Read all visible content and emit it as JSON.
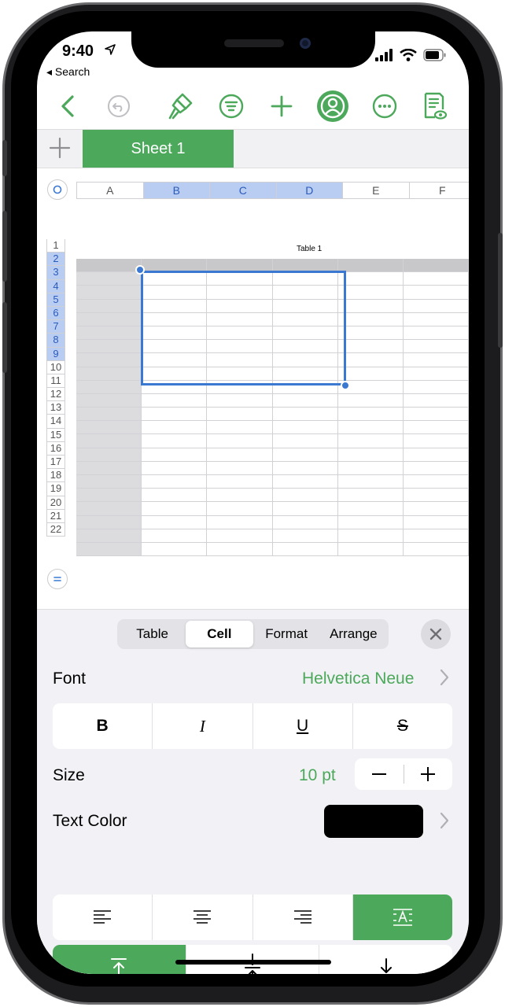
{
  "status_bar": {
    "time": "9:40",
    "location_icon": "location-arrow-icon",
    "back_label": "◂ Search"
  },
  "toolbar": {
    "icons": [
      "back-chevron-icon",
      "undo-icon",
      "paintbrush-icon",
      "filter-icon",
      "add-icon",
      "collaborate-icon",
      "more-icon",
      "reader-view-icon"
    ],
    "accent_color": "#4ca85a"
  },
  "tabs": {
    "add_label": "+",
    "sheets": [
      {
        "label": "Sheet 1",
        "active": true
      }
    ]
  },
  "spreadsheet": {
    "columns": [
      "A",
      "B",
      "C",
      "D",
      "E",
      "F"
    ],
    "selected_columns": [
      "B",
      "C",
      "D"
    ],
    "table_title": "Table 1",
    "rows": [
      "1",
      "2",
      "3",
      "4",
      "5",
      "6",
      "7",
      "8",
      "9",
      "10",
      "11",
      "12",
      "13",
      "14",
      "15",
      "16",
      "17",
      "18",
      "19",
      "20",
      "21",
      "22"
    ],
    "selected_rows": [
      "2",
      "3",
      "4",
      "5",
      "6",
      "7",
      "8",
      "9"
    ],
    "selection": "B2:D9"
  },
  "inspector": {
    "segments": [
      {
        "label": "Table",
        "active": false
      },
      {
        "label": "Cell",
        "active": true
      },
      {
        "label": "Format",
        "active": false
      },
      {
        "label": "Arrange",
        "active": false
      }
    ],
    "font_label": "Font",
    "font_value": "Helvetica Neue",
    "style_buttons": [
      {
        "label": "B",
        "name": "bold-button"
      },
      {
        "label": "I",
        "name": "italic-button"
      },
      {
        "label": "U",
        "name": "underline-button"
      },
      {
        "label": "S",
        "name": "strikethrough-button"
      }
    ],
    "size_label": "Size",
    "size_value": "10 pt",
    "text_color_label": "Text Color",
    "text_color_value": "#000000",
    "horizontal_alignment": [
      "align-left-icon",
      "align-center-icon",
      "align-right-icon",
      "auto-align-icon"
    ],
    "horizontal_alignment_selected": "auto-align-icon",
    "vertical_alignment": [
      "align-top-icon",
      "align-middle-icon",
      "align-bottom-icon"
    ],
    "vertical_alignment_selected": "align-top-icon"
  }
}
